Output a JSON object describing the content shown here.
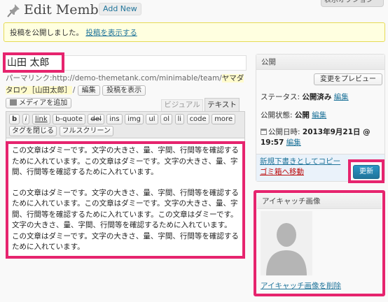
{
  "header": {
    "title": "Edit Member",
    "add_new": "Add New",
    "screen_options": "表示オプション"
  },
  "notice": {
    "message": "投稿を公開しました。",
    "link": "投稿を表示する"
  },
  "post": {
    "title": "山田 太郎",
    "permalink_label": "パーマリンク:",
    "permalink_url": "http://demo-themetank.com/minimable/team/",
    "permalink_slug": "ヤマダタロウ［山田太郎］",
    "edit_button": "編集",
    "view_button": "投稿を表示"
  },
  "editor": {
    "add_media": "メディアを追加",
    "tab_visual": "ビジュアル",
    "tab_text": "テキスト",
    "toolbar_row1": [
      "b",
      "i",
      "link",
      "b-quote",
      "del",
      "ins",
      "img",
      "ul",
      "ol",
      "li",
      "code",
      "more"
    ],
    "toolbar_row2": [
      "タグを閉じる",
      "フルスクリーン"
    ],
    "paragraph1": "この文章はダミーです。文字の大きさ、量、字間、行間等を確認するために入れています。この文章はダミーです。文字の大きさ、量、字間、行間等を確認するために入れています。",
    "paragraph2": "この文章はダミーです。文字の大きさ、量、字間、行間等を確認するために入れています。この文章はダミーです。文字の大きさ、量、字間、行間等を確認するために入れています。この文章はダミーです。文字の大きさ、量、字間、行間等を確認するために入れています。この文章はダミーです。文字の大きさ、量、字間、行間等を確認するために入れています。"
  },
  "publish": {
    "heading": "公開",
    "preview_button": "変更をプレビュー",
    "status_label": "ステータス:",
    "status_value": "公開済み",
    "visibility_label": "公開状態:",
    "visibility_value": "公開",
    "date_label": "公開日時:",
    "date_value": "2013年9月21日 @",
    "time_value": "19:57",
    "edit_link": "編集",
    "copy_draft": "新規下書きとしてコピー",
    "trash": "ゴミ箱へ移動",
    "update_button": "更新"
  },
  "eyecatch": {
    "heading": "アイキャッチ画像",
    "remove_link": "アイキャッチ画像を削除"
  },
  "colors": {
    "highlight": "#e6246e",
    "link": "#21759b",
    "trash": "#bc0b0b",
    "primary_button": "#21759b"
  }
}
